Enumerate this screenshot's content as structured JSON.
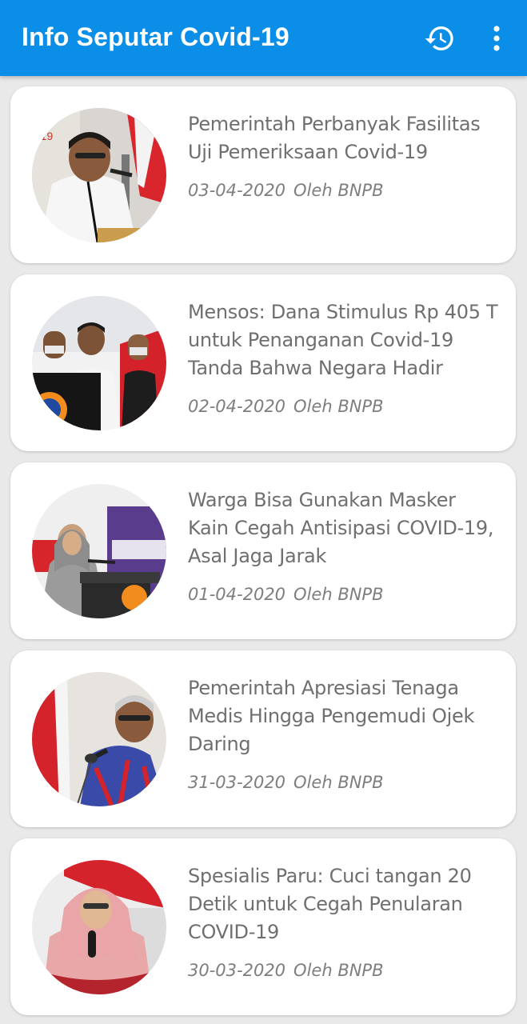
{
  "appbar": {
    "title": "Info Seputar Covid-19",
    "icons": [
      "history-icon",
      "more-vert-icon"
    ],
    "color": "#0a8ee8"
  },
  "articles": [
    {
      "title": "Pemerintah Perbanyak Fasilitas Uji Pemeriksaan Covid-19",
      "date": "03-04-2020",
      "author": "Oleh BNPB"
    },
    {
      "title": "Mensos: Dana Stimulus Rp 405 T untuk Penanganan Covid-19 Tanda Bahwa Negara Hadir",
      "date": "02-04-2020",
      "author": "Oleh BNPB"
    },
    {
      "title": "Warga Bisa Gunakan Masker Kain Cegah Antisipasi COVID-19, Asal Jaga Jarak",
      "date": "01-04-2020",
      "author": "Oleh BNPB"
    },
    {
      "title": "Pemerintah Apresiasi Tenaga Medis Hingga Pengemudi Ojek Daring",
      "date": "31-03-2020",
      "author": "Oleh BNPB"
    },
    {
      "title": "Spesialis Paru: Cuci tangan 20 Detik untuk Cegah Penularan COVID-19",
      "date": "30-03-2020",
      "author": "Oleh BNPB"
    }
  ]
}
